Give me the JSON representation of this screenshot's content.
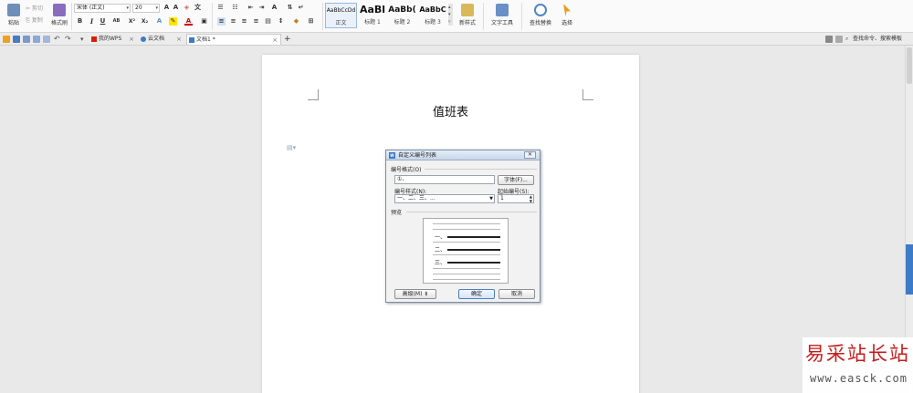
{
  "ribbon": {
    "clipboard": {
      "paste_label": "粘贴",
      "cut_label": "剪切",
      "copy_label": "复制",
      "format_painter_label": "格式刷"
    },
    "font": {
      "family": "宋体 (正文)",
      "size": "20",
      "bold": "B",
      "italic": "I",
      "underline": "U",
      "superscript": "X²",
      "subscript": "X₂"
    },
    "styles": [
      {
        "sample": "AaBbCcDd",
        "name": "正文"
      },
      {
        "sample": "AaBl",
        "name": "标题 1"
      },
      {
        "sample": "AaBb(",
        "name": "标题 2"
      },
      {
        "sample": "AaBbC",
        "name": "标题 3"
      }
    ],
    "new_style_label": "新样式",
    "text_tools_label": "文字工具",
    "find_replace_label": "查找替换",
    "select_label": "选择"
  },
  "tabbar": {
    "tabs": [
      {
        "label": "我的WPS",
        "active": false
      },
      {
        "label": "云文档",
        "active": false
      },
      {
        "label": "文档1 *",
        "active": true
      }
    ],
    "add_tab": "+",
    "search_placeholder": "查找命令、搜索模板"
  },
  "document": {
    "title": "值班表"
  },
  "dialog": {
    "title": "自定义编号列表",
    "close": "✕",
    "number_format_label": "编号格式(O)",
    "number_format_value": "①、",
    "font_button": "字体(F)...",
    "number_style_label": "编号样式(N):",
    "number_style_value": "一、二、三、...",
    "start_number_label": "起始编号(S):",
    "start_number_value": "1",
    "preview_label": "预览",
    "preview_items": [
      "一、",
      "二、",
      "三、"
    ],
    "advanced_button": "高级(M) ⇟",
    "ok_button": "确定",
    "cancel_button": "取消"
  },
  "watermark": {
    "line1": "易采站长站",
    "line2": "www.easck.com"
  },
  "colors": {
    "accent": "#3d7bc7",
    "wps_red": "#d81e06",
    "watermark_red": "#c41d1d"
  }
}
